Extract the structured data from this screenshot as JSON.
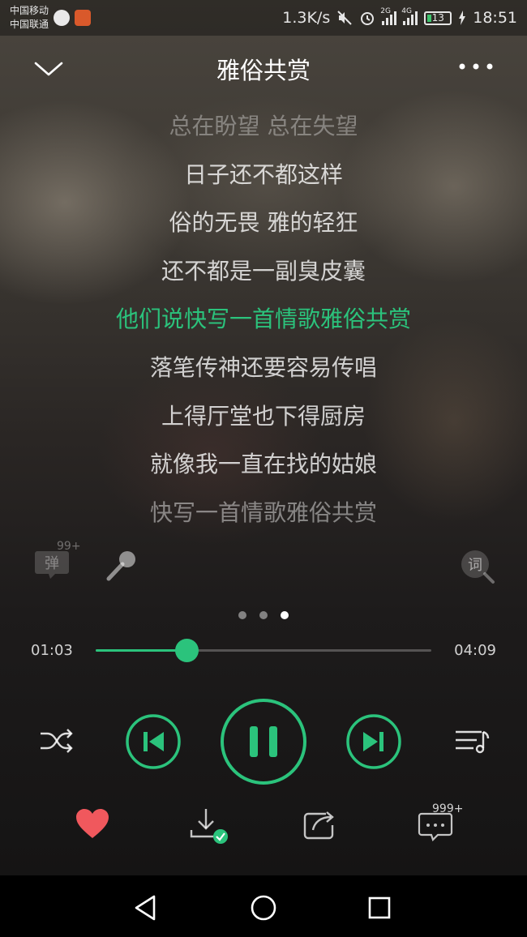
{
  "status_bar": {
    "carrier_1": "中国移动",
    "carrier_2": "中国联通",
    "speed": "1.3K/s",
    "net_2g": "2G",
    "net_4g": "4G",
    "battery": "13",
    "time": "18:51"
  },
  "header": {
    "title": "雅俗共赏"
  },
  "lyrics": [
    "总在盼望 总在失望",
    "日子还不都这样",
    "俗的无畏 雅的轻狂",
    "还不都是一副臭皮囊",
    "他们说快写一首情歌雅俗共赏",
    "落笔传神还要容易传唱",
    "上得厅堂也下得厨房",
    "就像我一直在找的姑娘",
    "快写一首情歌雅俗共赏"
  ],
  "active_lyric_index": 4,
  "tools": {
    "danmu_label": "弹",
    "danmu_count": "99+",
    "ci_label": "词"
  },
  "pager": {
    "pages": 3,
    "current": 3
  },
  "progress": {
    "current": "01:03",
    "total": "04:09",
    "fraction": 0.27
  },
  "actions": {
    "comment_count": "999+"
  },
  "colors": {
    "accent": "#2bc37c",
    "heart": "#f0585d"
  }
}
